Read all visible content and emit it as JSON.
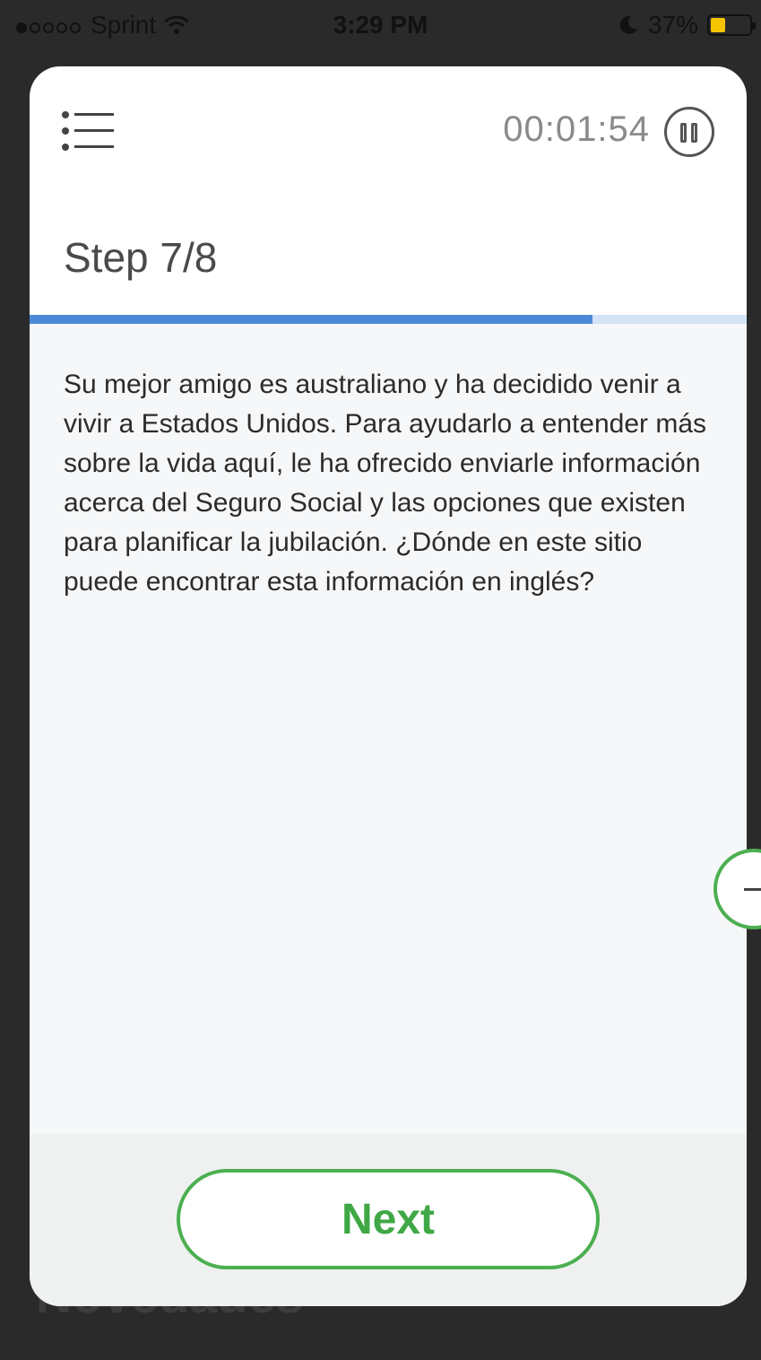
{
  "status_bar": {
    "carrier": "Sprint",
    "time": "3:29 PM",
    "battery": "37%",
    "battery_level": 0.37,
    "signal_bars_filled": 1,
    "signal_bars_total": 5,
    "icons": [
      "wifi-icon",
      "moon-icon",
      "battery-icon"
    ]
  },
  "background": {
    "heading": "Novedades"
  },
  "task": {
    "timer": "00:01:54",
    "step_label": "Step 7/8",
    "progress": 0.785,
    "question": "Su mejor amigo es australiano y ha decidido venir a vivir a Estados Unidos. Para ayudarlo a entender más sobre la vida aquí, le ha ofrecido enviarle información acerca del Seguro Social y las opciones que existen para planificar la jubilación. ¿Dónde en este sitio puede encontrar esta información en inglés?",
    "next_label": "Next"
  },
  "colors": {
    "accent_green": "#4caf50",
    "progress_blue": "#4a8ad8",
    "progress_track": "#d4e3f6"
  }
}
